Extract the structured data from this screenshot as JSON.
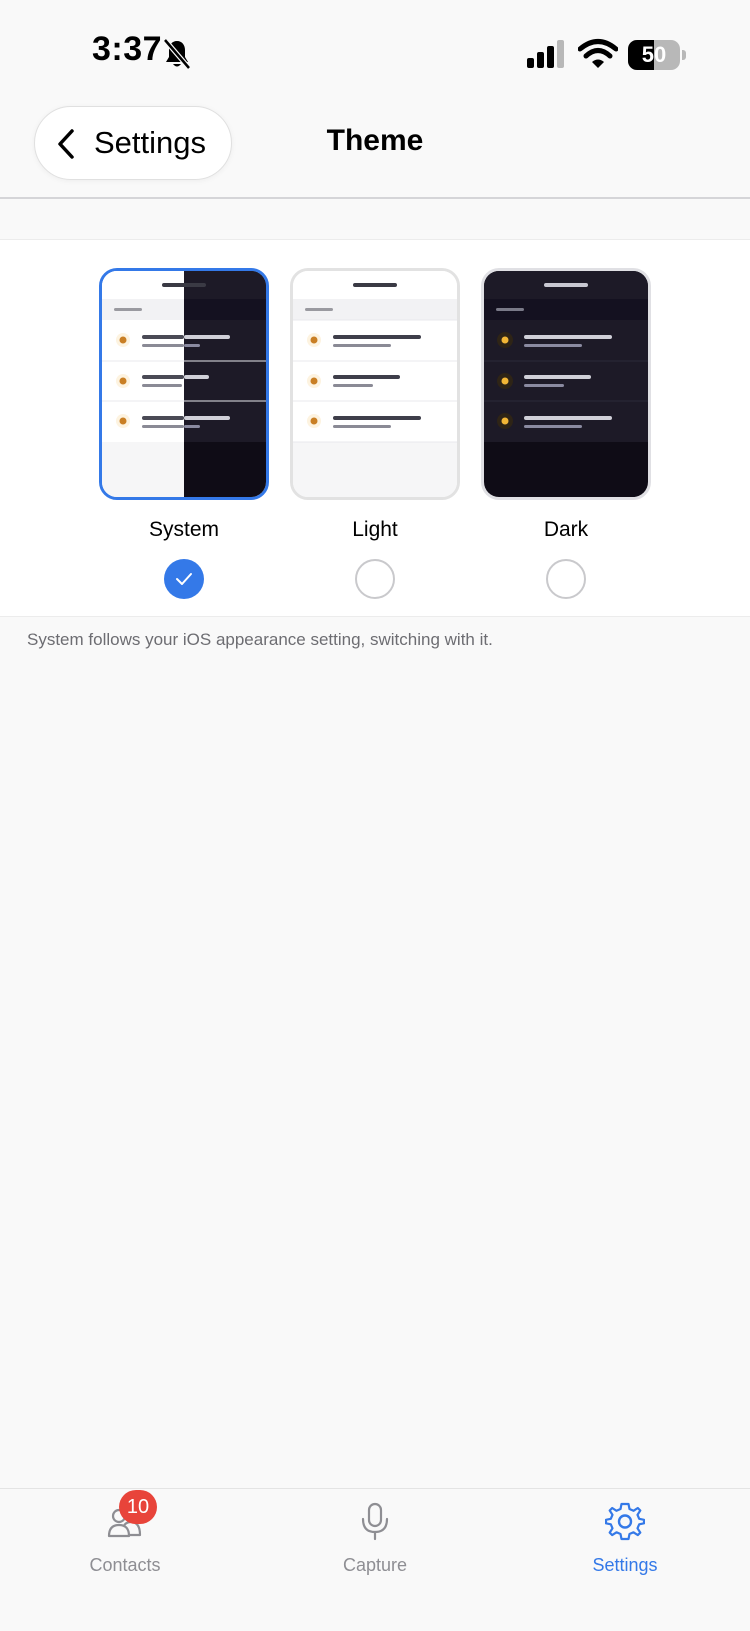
{
  "status_bar": {
    "time": "3:37",
    "battery_level": "50",
    "battery_fraction": 0.5
  },
  "nav": {
    "back_label": "Settings",
    "title": "Theme"
  },
  "theme_options": [
    {
      "label": "System",
      "selected": true
    },
    {
      "label": "Light",
      "selected": false
    },
    {
      "label": "Dark",
      "selected": false
    }
  ],
  "hint": "System follows your iOS appearance setting, switching with it.",
  "tab_bar": {
    "tabs": [
      {
        "label": "Contacts",
        "icon": "contacts-icon",
        "badge": "10",
        "active": false
      },
      {
        "label": "Capture",
        "icon": "microphone-icon",
        "active": false
      },
      {
        "label": "Settings",
        "icon": "gear-icon",
        "active": true
      }
    ]
  },
  "colors": {
    "accent": "#3479e8",
    "badge": "#e8443a",
    "dark_preview_bg": "#1d1a27",
    "dot_amber": "#f2b636"
  }
}
